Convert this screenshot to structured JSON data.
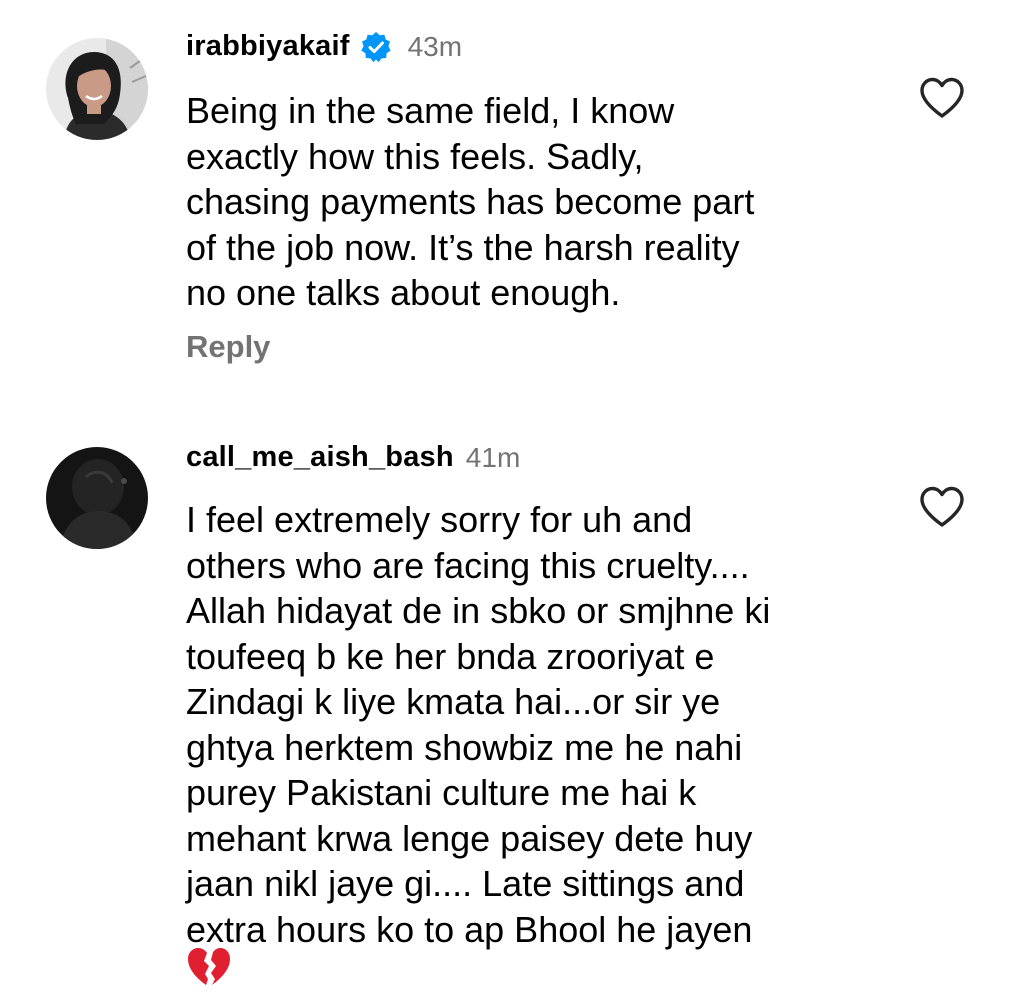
{
  "comments": [
    {
      "username": "irabbiyakaif",
      "verified": true,
      "time": "43m",
      "avatar_icon": "profile-photo-woman",
      "text": "Being in the same field, I know\nexactly how this feels. Sadly,\nchasing payments has become part\nof the job now. It’s the harsh reality\nno one talks about enough.",
      "reply_label": "Reply",
      "like_icon": "heart-outline-icon"
    },
    {
      "username": "call_me_aish_bash",
      "verified": false,
      "time": "41m",
      "avatar_icon": "profile-photo-dark-silhouette",
      "text": "I feel extremely sorry for uh and\nothers who are facing this cruelty....\nAllah hidayat de in sbko or smjhne ki\ntoufeeq b ke her bnda zrooriyat e\nZindagi k liye kmata hai...or sir ye\nghtya herktem showbiz me he nahi\npurey Pakistani culture me hai k\nmehant krwa lenge paisey dete huy\njaan nikl jaye gi.... Late sittings and\nextra hours ko to ap Bhool he jayen",
      "trailing_emoji": "broken-heart-emoji",
      "like_icon": "heart-outline-icon"
    }
  ],
  "colors": {
    "verified_badge": "#0095f6",
    "secondary_text": "#737373",
    "broken_heart": "#e02030"
  }
}
